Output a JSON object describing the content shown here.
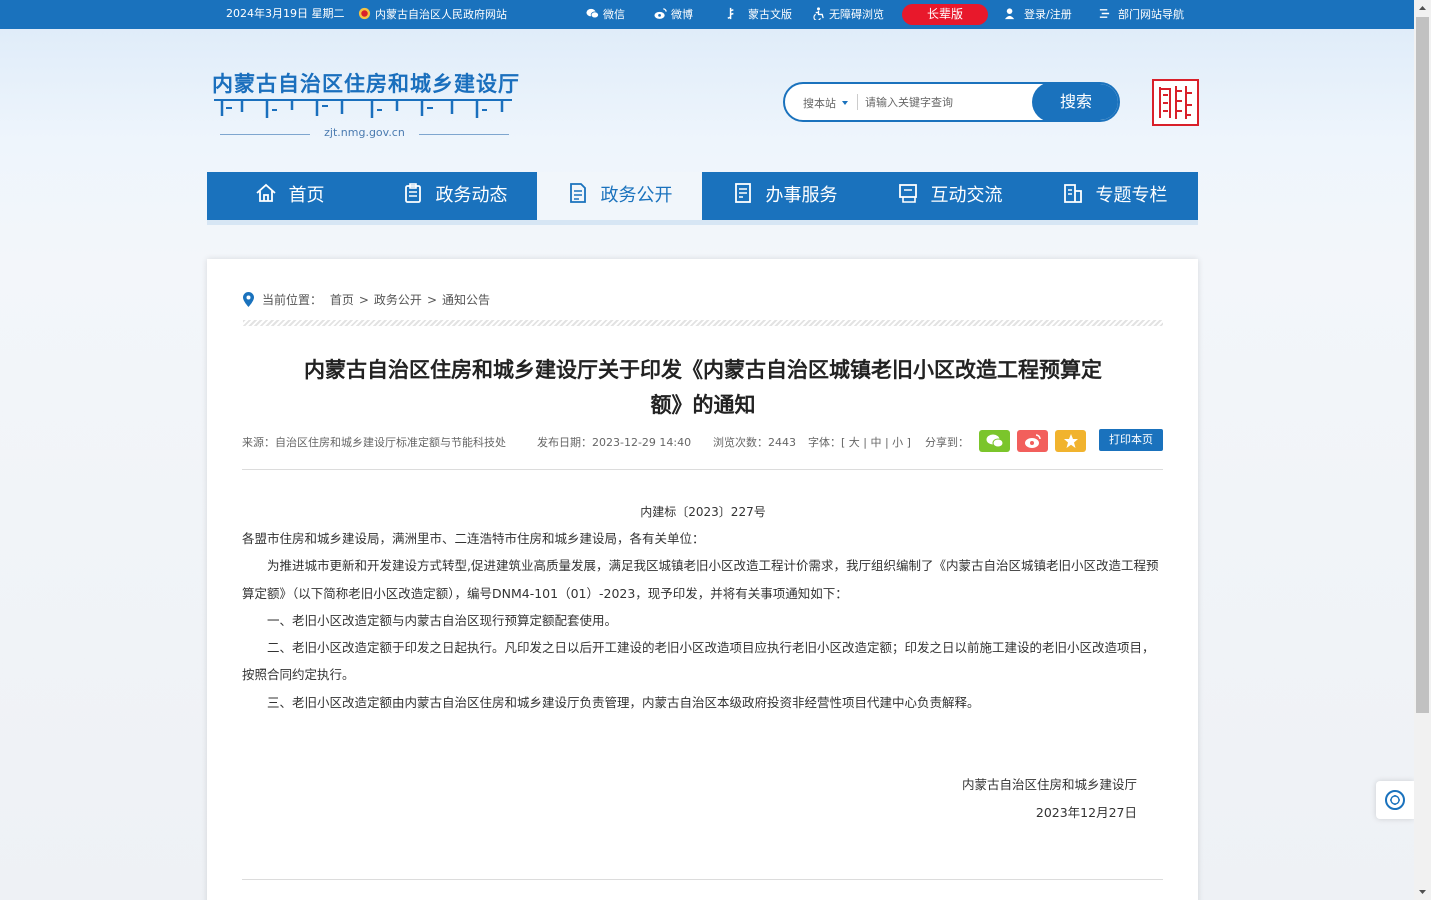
{
  "topbar": {
    "date": "2024年3月19日 星期二",
    "gov_link": "内蒙古自治区人民政府网站",
    "wechat": "微信",
    "weibo": "微博",
    "mongolian": "蒙古文版",
    "accessible": "无障碍浏览",
    "elder": "长辈版",
    "login": "登录/注册",
    "dept_nav": "部门网站导航"
  },
  "header": {
    "title": "内蒙古自治区住房和城乡建设厅",
    "url": "zjt.nmg.gov.cn",
    "search_scope": "搜本站",
    "search_placeholder": "请输入关键字查询",
    "search_button": "搜索",
    "seal_icon": "inner-mongolia-seal-icon"
  },
  "nav": {
    "items": [
      {
        "label": "首页",
        "icon": "home-icon"
      },
      {
        "label": "政务动态",
        "icon": "clipboard-icon"
      },
      {
        "label": "政务公开",
        "icon": "document-icon"
      },
      {
        "label": "办事服务",
        "icon": "form-icon"
      },
      {
        "label": "互动交流",
        "icon": "chat-icon"
      },
      {
        "label": "专题专栏",
        "icon": "folder-icon"
      }
    ],
    "active_index": 2
  },
  "breadcrumb": {
    "prefix": "当前位置：",
    "items": [
      "首页",
      "政务公开",
      "通知公告"
    ],
    "separator": ">"
  },
  "article": {
    "title_line1": "内蒙古自治区住房和城乡建设厅关于印发《内蒙古自治区城镇老旧小区改造工程预算定",
    "title_line2": "额》的通知",
    "source": "来源：自治区住房和城乡建设厅标准定额与节能科技处",
    "date": "发布日期：2023-12-29 14:40",
    "views": "浏览次数：2443",
    "font_size": "字体：[ 大 | 中 | 小 ]",
    "share_label": "分享到：",
    "print_button": "打印本页",
    "doc_number": "内建标〔2023〕227号",
    "salutation": "各盟市住房和城乡建设局，满洲里市、二连浩特市住房和城乡建设局，各有关单位：",
    "para1": "为推进城市更新和开发建设方式转型,促进建筑业高质量发展，满足我区城镇老旧小区改造工程计价需求，我厅组织编制了《内蒙古自治区城镇老旧小区改造工程预算定额》（以下简称老旧小区改造定额），编号DNM4-101（01）-2023，现予印发，并将有关事项通知如下：",
    "para2": "一、老旧小区改造定额与内蒙古自治区现行预算定额配套使用。",
    "para3": "二、老旧小区改造定额于印发之日起执行。凡印发之日以后开工建设的老旧小区改造项目应执行老旧小区改造定额；印发之日以前施工建设的老旧小区改造项目，按照合同约定执行。",
    "para4": "三、老旧小区改造定额由内蒙古自治区住房和城乡建设厅负责管理，内蒙古自治区本级政府投资非经营性项目代建中心负责解释。",
    "signer": "内蒙古自治区住房和城乡建设厅",
    "sign_date": "2023年12月27日"
  },
  "colors": {
    "brand_blue": "#1a72bd",
    "elder_red": "#e8182b",
    "wechat_green": "#7bc52b",
    "weibo_red": "#f25f5c",
    "favorite_yellow": "#f1b32e"
  }
}
